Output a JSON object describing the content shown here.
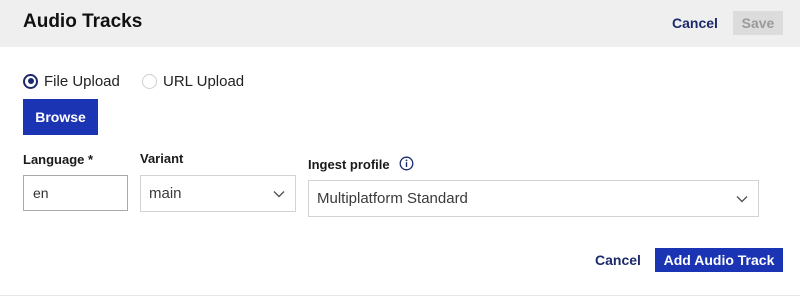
{
  "header": {
    "title": "Audio Tracks",
    "cancel_label": "Cancel",
    "save_label": "Save"
  },
  "upload_mode": {
    "options": [
      {
        "label": "File Upload",
        "selected": true
      },
      {
        "label": "URL Upload",
        "selected": false
      }
    ]
  },
  "browse_label": "Browse",
  "fields": {
    "language": {
      "label": "Language *",
      "value": "en"
    },
    "variant": {
      "label": "Variant",
      "value": "main"
    },
    "ingest_profile": {
      "label": "Ingest profile",
      "value": "Multiplatform Standard"
    }
  },
  "footer": {
    "cancel_label": "Cancel",
    "add_label": "Add Audio Track"
  },
  "colors": {
    "primary": "#1b34b3",
    "link": "#1c2a6b",
    "header_bg": "#efefef"
  },
  "icons": {
    "info": "info-circle-icon",
    "chevron": "chevron-down-icon"
  }
}
